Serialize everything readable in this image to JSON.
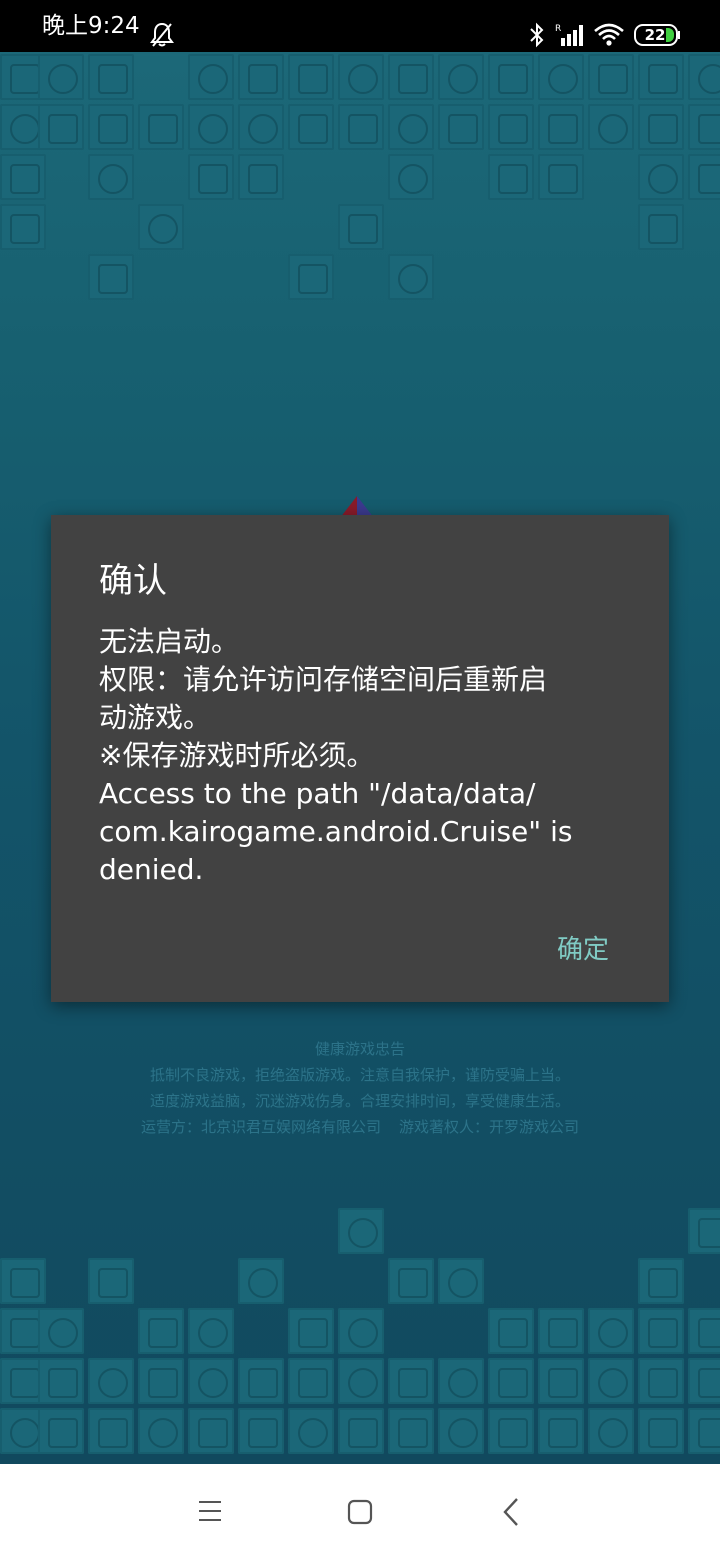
{
  "status_bar": {
    "time": "晚上9:24",
    "battery": "22",
    "icons": [
      "bell-off-icon",
      "bluetooth-icon",
      "signal-icon",
      "wifi-icon",
      "battery-icon"
    ]
  },
  "dialog": {
    "title": "确认",
    "message_lines": [
      "无法启动。",
      "权限：请允许访问存储空间后重新启",
      "动游戏。",
      "※保存游戏时所必须。",
      "Access to the path \"/data/data/",
      "com.kairogame.android.Cruise\" is",
      "denied."
    ],
    "ok_label": "确定"
  },
  "notice": {
    "heading": "健康游戏忠告",
    "line1": "抵制不良游戏，拒绝盗版游戏。注意自我保护，谨防受骗上当。",
    "line2": "适度游戏益脑，沉迷游戏伤身。合理安排时间，享受健康生活。",
    "operator": "运营方：北京识君互娱网络有限公司",
    "copyright": "游戏著权人：开罗游戏公司"
  },
  "colors": {
    "status_bar": "#000000",
    "background": "#12495e",
    "dialog": "#424242",
    "accent": "#80cbc4",
    "notice_text": "#2c7389"
  },
  "nav_bar": {
    "icons": [
      "menu-icon",
      "home-icon",
      "back-icon"
    ]
  }
}
